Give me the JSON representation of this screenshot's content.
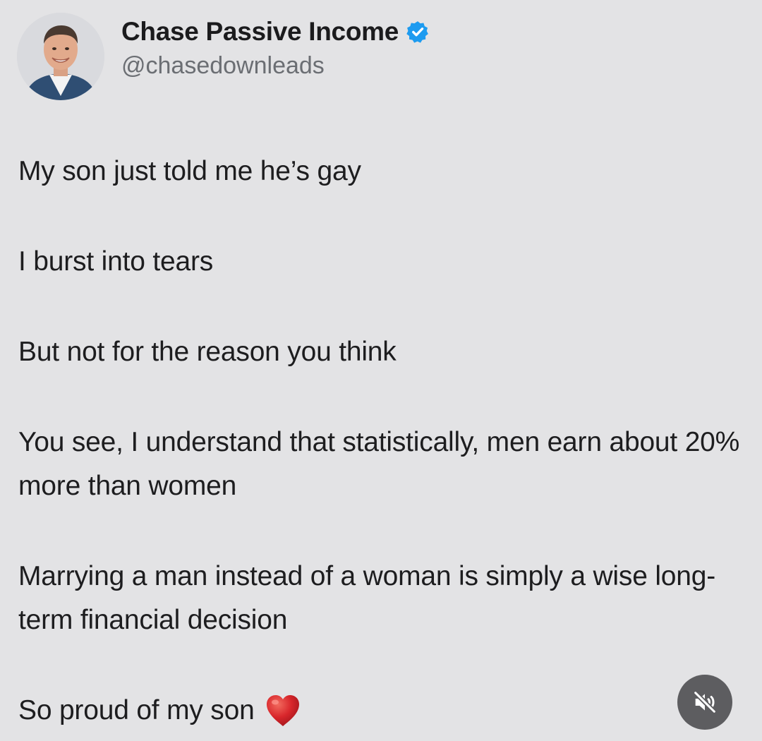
{
  "author": {
    "display_name": "Chase Passive Income",
    "handle": "@chasedownleads",
    "verified": true
  },
  "post": {
    "paragraphs": [
      "My son just told me he’s gay",
      "I burst into tears",
      "But not for the reason you think",
      "You see, I understand that statistically, men earn about 20% more than women",
      "Marrying a man instead of a woman is simply a wise long-term financial decision",
      "So proud of my son"
    ],
    "trailing_emoji": "heart-icon"
  },
  "controls": {
    "mute_button_icon": "speaker-muted-icon"
  },
  "colors": {
    "background": "#e3e3e5",
    "verified_badge": "#1d9bf0",
    "heart": "#d8262b",
    "mute_button": "#5d5d60"
  }
}
